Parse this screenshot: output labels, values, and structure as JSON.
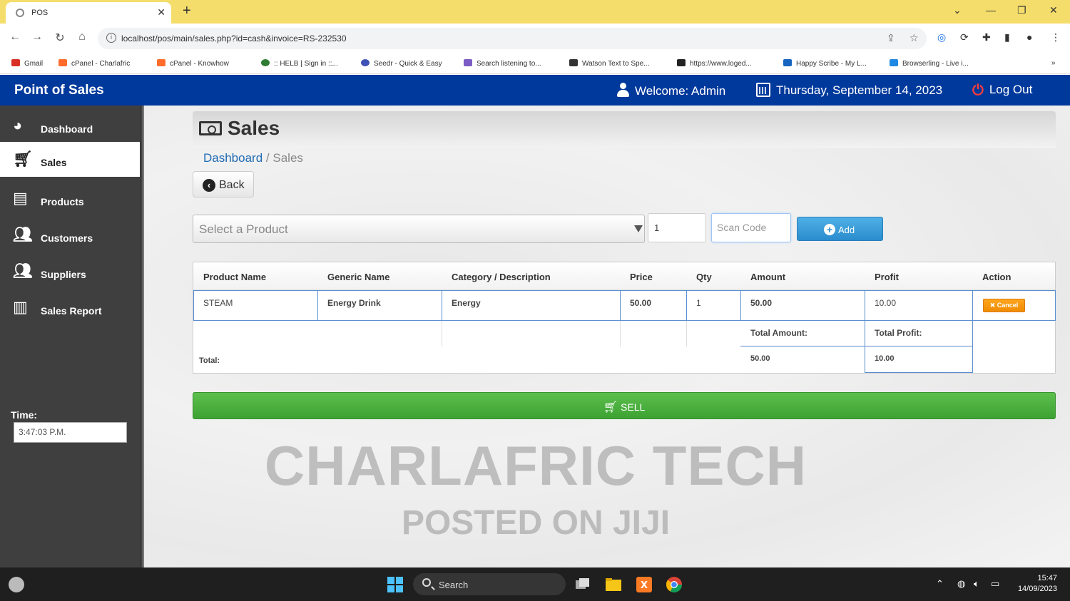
{
  "browser": {
    "tab_title": "POS",
    "url": "localhost/pos/main/sales.php?id=cash&invoice=RS-232530",
    "bookmarks": [
      {
        "label": "Gmail",
        "color": "#d93025"
      },
      {
        "label": "cPanel - Charlafric",
        "color": "#ff6c2c"
      },
      {
        "label": "cPanel - Knowhow",
        "color": "#ff6c2c"
      },
      {
        "label": ":: HELB | Sign in ::...",
        "color": "#2e7d32"
      },
      {
        "label": "Seedr - Quick & Easy",
        "color": "#3f51b5"
      },
      {
        "label": "Search listening to...",
        "color": "#7b5cc4"
      },
      {
        "label": "Watson Text to Spe...",
        "color": "#333333"
      },
      {
        "label": "https://www.loged...",
        "color": "#222222"
      },
      {
        "label": "Happy Scribe - My L...",
        "color": "#1565c0"
      },
      {
        "label": "Browserling - Live i...",
        "color": "#1e88e5"
      }
    ],
    "more_bookmarks": "»"
  },
  "header": {
    "brand": "Point of Sales",
    "welcome": "Welcome: Admin",
    "date": "Thursday, September 14, 2023",
    "logout": "Log Out"
  },
  "sidebar": {
    "items": [
      {
        "label": "Dashboard",
        "icon": "dashboard-icon"
      },
      {
        "label": "Sales",
        "icon": "cart-icon",
        "active": true
      },
      {
        "label": "Products",
        "icon": "list-icon"
      },
      {
        "label": "Customers",
        "icon": "users-icon"
      },
      {
        "label": "Suppliers",
        "icon": "users-icon"
      },
      {
        "label": "Sales Report",
        "icon": "bar-chart-icon"
      }
    ],
    "time_label": "Time:",
    "time_value": "3:47:03 P.M."
  },
  "page": {
    "title": "Sales",
    "breadcrumb": {
      "link": "Dashboard",
      "separator": "/",
      "current": "Sales"
    },
    "back_label": "Back",
    "product_placeholder": "Select a Product",
    "qty_value": "1",
    "scan_placeholder": "Scan Code",
    "add_label": "Add",
    "sell_label": "SELL"
  },
  "table": {
    "headers": [
      "Product Name",
      "Generic Name",
      "Category / Description",
      "Price",
      "Qty",
      "Amount",
      "Profit",
      "Action"
    ],
    "rows": [
      {
        "product": "STEAM",
        "generic": "Energy Drink",
        "category": "Energy",
        "price": "50.00",
        "qty": "1",
        "amount": "50.00",
        "profit": "10.00",
        "action": "✖ Cancel"
      }
    ],
    "total_label": "Total:",
    "total_amount_label": "Total Amount:",
    "total_profit_label": "Total Profit:",
    "total_amount": "50.00",
    "total_profit": "10.00"
  },
  "watermark": {
    "line1": "CHARLAFRIC TECH",
    "line2": "POSTED ON JIJI"
  },
  "taskbar": {
    "search": "Search",
    "time": "15:47",
    "date": "14/09/2023"
  }
}
